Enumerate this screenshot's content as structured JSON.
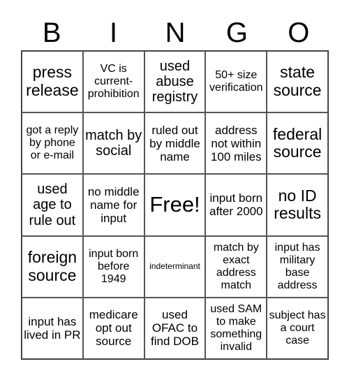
{
  "header": [
    "B",
    "I",
    "N",
    "G",
    "O"
  ],
  "cells": [
    "press release",
    "VC is current-prohibition",
    "used abuse registry",
    "50+ size verification",
    "state source",
    "got a reply by phone or e-mail",
    "match by social",
    "ruled out by middle name",
    "address not within 100 miles",
    "federal source",
    "used age to rule out",
    "no middle name for input",
    "Free!",
    "input born after 2000",
    "no ID results",
    "foreign source",
    "input born before 1949",
    "indeterminant",
    "match by exact address match",
    "input has military base address",
    "input has lived in PR",
    "medicare opt out source",
    "used OFAC to find DOB",
    "used SAM to make something invalid",
    "subject has a court case"
  ]
}
